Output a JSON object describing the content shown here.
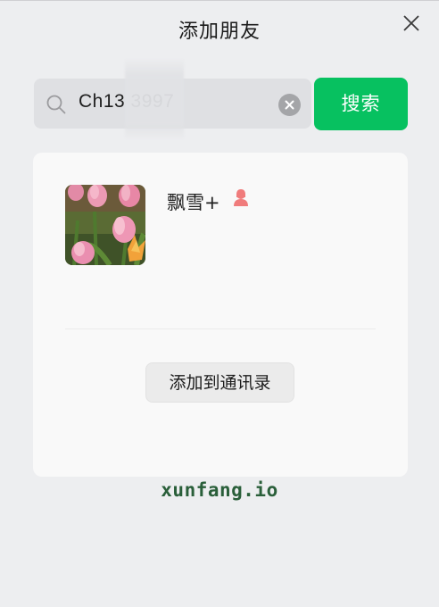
{
  "window": {
    "title": "添加朋友"
  },
  "search": {
    "value": "Ch13      3997",
    "button_label": "搜索"
  },
  "result": {
    "name": "飘雪+",
    "gender_icon": "female-person-icon",
    "add_button_label": "添加到通讯录"
  },
  "watermark": {
    "text": "xunfang.io"
  },
  "colors": {
    "accent_green": "#07c160",
    "gender_female": "#f07c7c",
    "watermark": "#2a5f3a"
  }
}
